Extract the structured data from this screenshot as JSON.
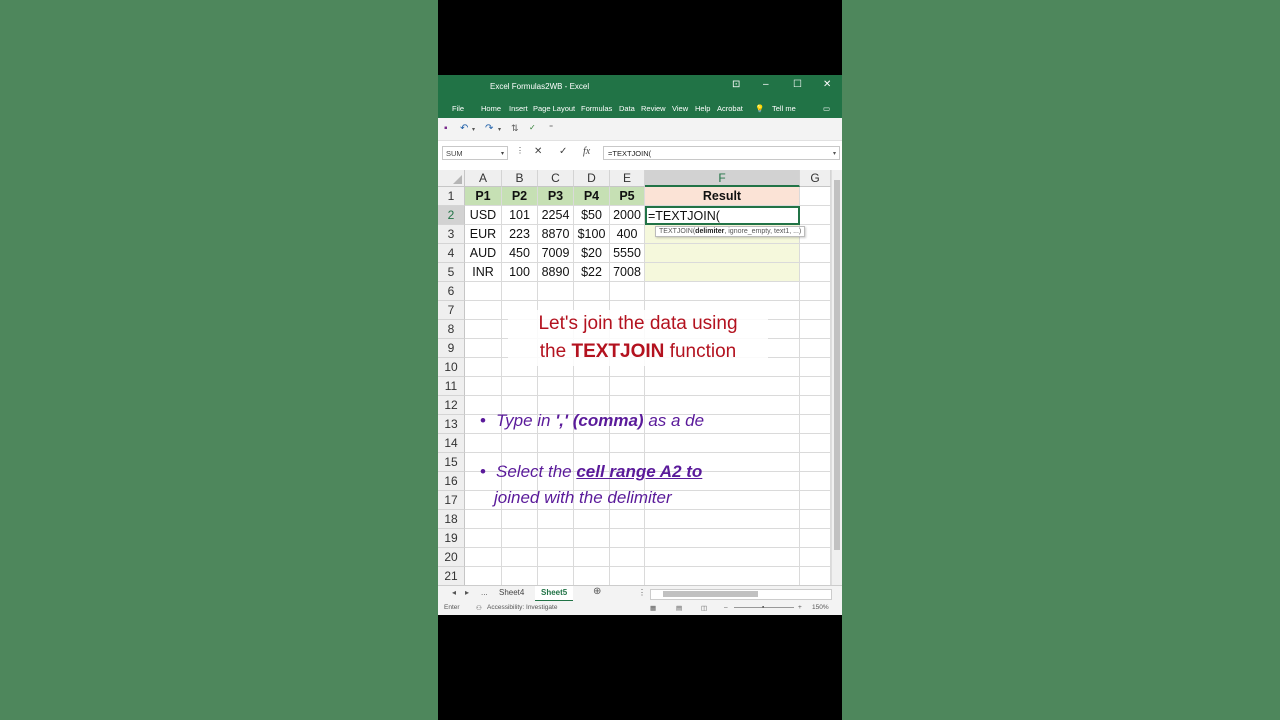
{
  "window": {
    "title": "Excel Formulas2WB  -  Excel",
    "min": "–",
    "max": "☐",
    "close": "✕",
    "ribbon_display": "⊡"
  },
  "ribbon": {
    "tabs": [
      "File",
      "Home",
      "Insert",
      "Page Layout",
      "Formulas",
      "Data",
      "Review",
      "View",
      "Help",
      "Acrobat"
    ],
    "tell_me": "Tell me"
  },
  "formula_bar": {
    "name_box": "SUM",
    "cancel": "✕",
    "enter": "✓",
    "fx": "fx",
    "content": "=TEXTJOIN("
  },
  "columns": [
    "A",
    "B",
    "C",
    "D",
    "E",
    "F",
    "G"
  ],
  "rows": [
    "1",
    "2",
    "3",
    "4",
    "5",
    "6",
    "7",
    "8",
    "9",
    "10",
    "11",
    "12",
    "13",
    "14",
    "15",
    "16",
    "17",
    "18",
    "19",
    "20",
    "21"
  ],
  "table": {
    "headers": [
      "P1",
      "P2",
      "P3",
      "P4",
      "P5"
    ],
    "result_header": "Result",
    "data": [
      [
        "USD",
        "101",
        "2254",
        "$50",
        "2000"
      ],
      [
        "EUR",
        "223",
        "8870",
        "$100",
        "400"
      ],
      [
        "AUD",
        "450",
        "7009",
        "$20",
        "5550"
      ],
      [
        "INR",
        "100",
        "8890",
        "$22",
        "7008"
      ]
    ],
    "active_cell_text": "=TEXTJOIN("
  },
  "tooltip": {
    "fn": "TEXTJOIN(",
    "arg_bold": "delimiter",
    "rest": ", ignore_empty, text1, ...)"
  },
  "overlay": {
    "line1": "Let's join the data using",
    "line2_pre": "the ",
    "line2_bold": "TEXTJOIN",
    "line2_post": " function",
    "bullet1_pre": "Type in ",
    "bullet1_bold": "',' (comma) ",
    "bullet1_post": "as a de",
    "bullet2_pre": "Select the ",
    "bullet2_ul": "cell range A2 to",
    "bullet2_line2": "joined with the delimiter"
  },
  "sheets": {
    "more": "...",
    "tabs": [
      "Sheet4",
      "Sheet5"
    ],
    "active": "Sheet5",
    "add": "⊕"
  },
  "status": {
    "mode": "Enter",
    "accessibility": "Accessibility: Investigate",
    "zoom": "150%"
  },
  "colors": {
    "excel_green": "#217346",
    "header_fill": "#c6e0b4",
    "result_header_fill": "#fbe3d6",
    "result_body_fill": "#f5f8dc",
    "overlay_red": "#b3121f",
    "overlay_purple": "#5a1a9a"
  }
}
